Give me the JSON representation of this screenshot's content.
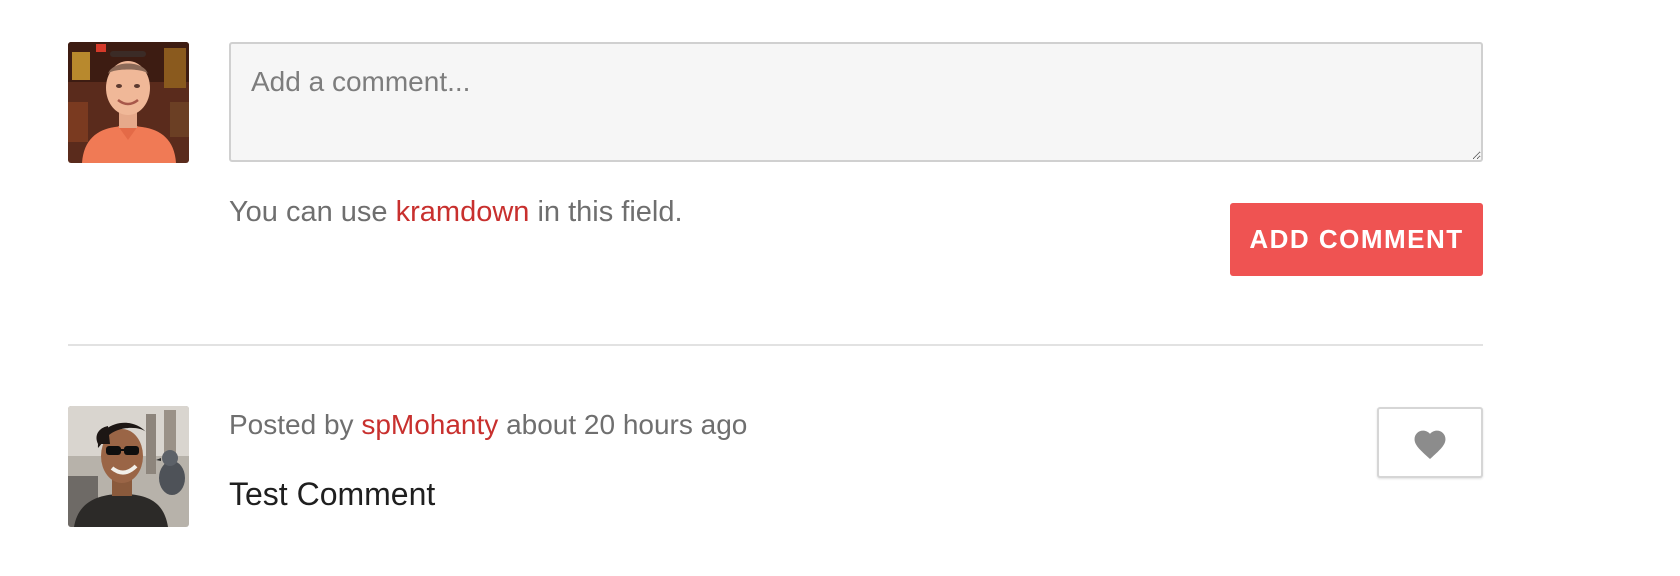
{
  "comment_form": {
    "placeholder": "Add a comment...",
    "value": "",
    "help_prefix": "You can use",
    "help_link": "kramdown",
    "help_suffix": "in this field.",
    "submit_label": "ADD COMMENT",
    "current_user_avatar_icon": "user-avatar-photo"
  },
  "comments": [
    {
      "posted_by_prefix": "Posted by",
      "author": "spMohanty",
      "time_ago": "about 20 hours ago",
      "body": "Test Comment",
      "avatar_icon": "user-avatar-photo",
      "like_icon": "heart-icon"
    }
  ],
  "colors": {
    "accent": "#ef5352",
    "link": "#c8302e",
    "muted_text": "#6f6f6f",
    "divider": "#e2e2e2",
    "heart": "#8c8c8c"
  }
}
